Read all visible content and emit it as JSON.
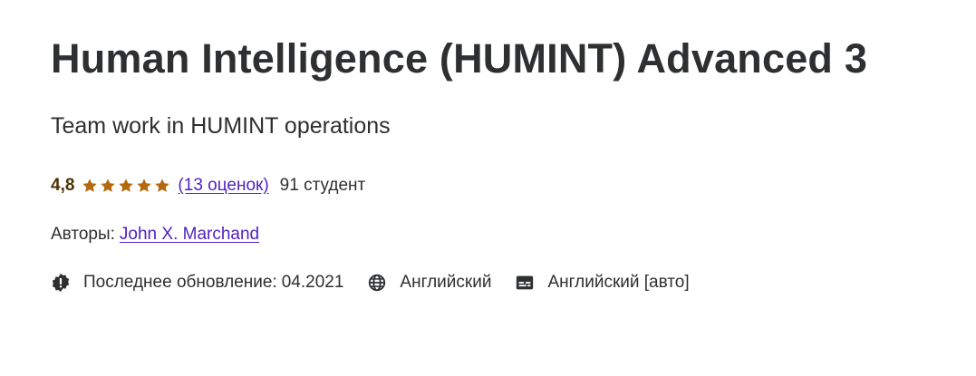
{
  "course": {
    "title": "Human Intelligence (HUMINT) Advanced 3",
    "subtitle": "Team work in HUMINT operations"
  },
  "rating": {
    "value": "4,8",
    "stars": 5,
    "star_color": "#b4690e",
    "count_label": "(13 оценок)",
    "students_label": "91 студент"
  },
  "authors": {
    "label": "Авторы:",
    "name": "John X. Marchand"
  },
  "meta": {
    "update_label": "Последнее обновление:",
    "update_date": "04.2021",
    "language": "Английский",
    "captions": "Английский [авто]"
  },
  "icons": {
    "update": "alert-badge-icon",
    "language": "globe-icon",
    "captions": "closed-captions-icon"
  },
  "colors": {
    "text": "#2d2f31",
    "link": "#5022c3",
    "rating": "#4d3105"
  }
}
